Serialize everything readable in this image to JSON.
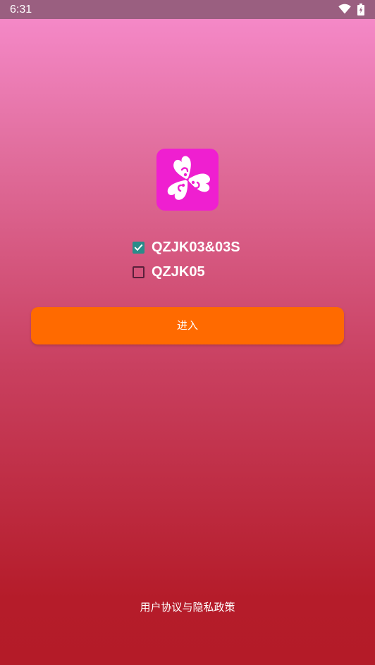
{
  "status_bar": {
    "time": "6:31",
    "icons": [
      "wifi-icon",
      "battery-icon"
    ]
  },
  "logo": {
    "icon": "clover-flower-logo",
    "background_color": "#ef1fd0"
  },
  "options": [
    {
      "label": "QZJK03&03S",
      "checked": true
    },
    {
      "label": "QZJK05",
      "checked": false
    }
  ],
  "enter_button": {
    "label": "进入",
    "color": "#ff6a00"
  },
  "privacy_link": {
    "label": "用户协议与隐私政策"
  },
  "colors": {
    "checkbox_checked": "#2a8c8a",
    "background_top": "#f78ccd",
    "background_bottom": "#b41b28"
  }
}
